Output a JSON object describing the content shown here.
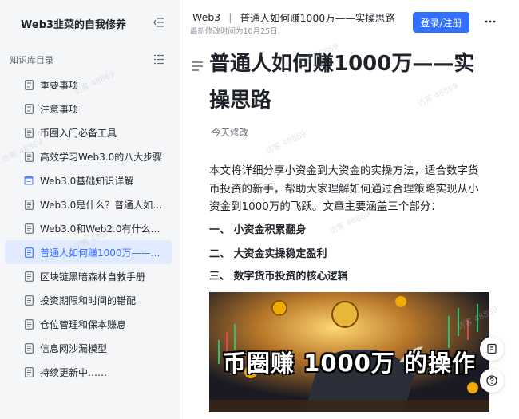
{
  "sidebar": {
    "space_title": "Web3韭菜的自我修养",
    "section_label": "知识库目录",
    "items": [
      {
        "label": "重要事项",
        "icon": "doc-icon",
        "active": false
      },
      {
        "label": "注意事项",
        "icon": "doc-icon",
        "active": false
      },
      {
        "label": "币圈入门必备工具",
        "icon": "doc-icon",
        "active": false
      },
      {
        "label": "高效学习Web3.0的八大步骤",
        "icon": "doc-icon",
        "active": false
      },
      {
        "label": "Web3.0基础知识详解",
        "icon": "calendar-icon",
        "active": false
      },
      {
        "label": "Web3.0是什么？普通人如何…",
        "icon": "doc-icon",
        "active": false
      },
      {
        "label": "Web3.0和Web2.0有什么区别…",
        "icon": "doc-icon",
        "active": false
      },
      {
        "label": "普通人如何赚1000万——实…",
        "icon": "doc-icon",
        "active": true
      },
      {
        "label": "区块链黑暗森林自救手册",
        "icon": "doc-icon",
        "active": false
      },
      {
        "label": "投资期限和时间的错配",
        "icon": "doc-icon",
        "active": false
      },
      {
        "label": "仓位管理和保本赚息",
        "icon": "doc-icon",
        "active": false
      },
      {
        "label": "信息网沙漏模型",
        "icon": "doc-icon",
        "active": false
      },
      {
        "label": "持续更新中……",
        "icon": "doc-icon",
        "active": false
      }
    ]
  },
  "header": {
    "breadcrumb_root": "Web3",
    "breadcrumb_sep": "|",
    "breadcrumb_current": "普通人如何赚1000万——实操思路",
    "modified": "最新修改时间为10月25日",
    "login_label": "登录/注册",
    "more_label": "···"
  },
  "doc": {
    "title": "普通人如何赚1000万——实操思路",
    "edit_status": "今天修改",
    "intro": "本文将详细分享小资金到大资金的实操方法，适合数字货币投资的新手，帮助大家理解如何通过合理策略实现从小资金到1000万的飞跃。文章主要涵盖三个部分：",
    "sections": [
      "一、 小资金积累翻身",
      "二、 大资金实操稳定盈利",
      "三、 数字货币投资的核心逻辑"
    ],
    "cover_caption": "币圈赚 1000万 的操作"
  },
  "watermark": "访客 48869",
  "colors": {
    "accent": "#3370ff",
    "active_bg": "#e1eaff",
    "sidebar_bg": "#f5f6f7"
  }
}
